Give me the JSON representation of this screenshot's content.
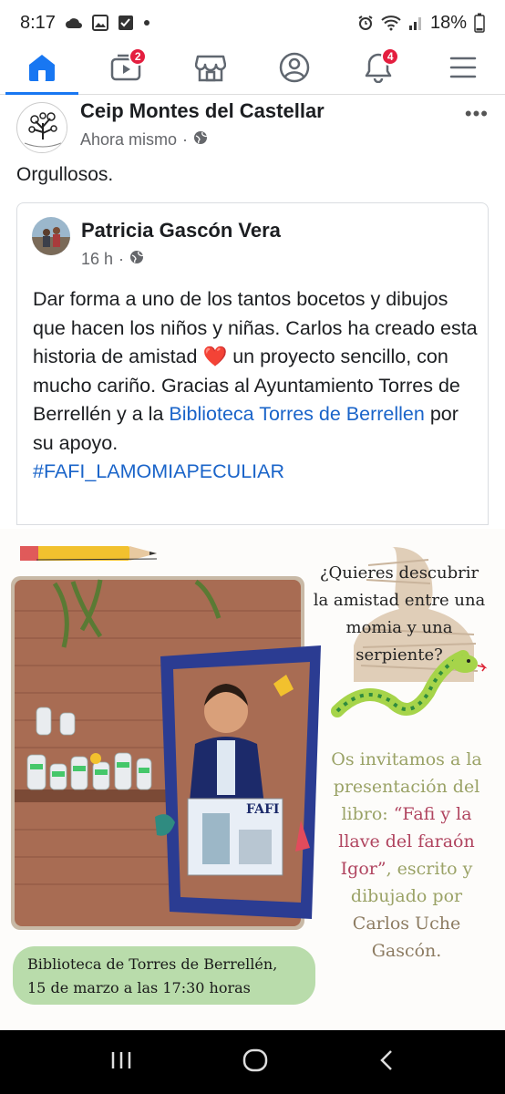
{
  "status_bar": {
    "time": "8:17",
    "battery": "18%"
  },
  "tabs": [
    {
      "name": "home",
      "badge": ""
    },
    {
      "name": "video",
      "badge": "2"
    },
    {
      "name": "marketplace",
      "badge": ""
    },
    {
      "name": "profile",
      "badge": ""
    },
    {
      "name": "notifications",
      "badge": "4"
    },
    {
      "name": "menu",
      "badge": ""
    }
  ],
  "post": {
    "author": "Ceip Montes del Castellar",
    "time": "Ahora mismo",
    "text": "Orgullosos.",
    "more": "•••"
  },
  "shared": {
    "author": "Patricia Gascón Vera",
    "time": "16 h",
    "body_1": "Dar forma a uno de los tantos bocetos y dibujos que hacen los niños y niñas. Carlos ha creado esta historia de amistad ",
    "heart": "❤️",
    "body_2": " un proyecto sencillo, con mucho cariño. Gracias al Ayuntamiento Torres de Berrellén y a la ",
    "link": "Biblioteca Torres de Berrellen",
    "body_3": " por su apoyo.",
    "hashtag": "#FAFI_LAMOMIAPECULIAR"
  },
  "poster": {
    "question": "¿Quieres descubrir la amistad entre una momia y una serpiente?",
    "invite_1": "Os invitamos a la presentación del libro: ",
    "invite_title": "“Fafi y la llave del faraón Igor”",
    "invite_2": ", escrito y dibujado por ",
    "invite_author": "Carlos Uche Gascón.",
    "book_title": "FAFI",
    "caption_line1": "Biblioteca de Torres de Berrellén,",
    "caption_line2": "15 de marzo a las 17:30 horas"
  },
  "colors": {
    "fb_blue": "#1877f2",
    "link_blue": "#1a64c9",
    "badge_red": "#e41e3f",
    "pill_green": "#b9dcab"
  }
}
